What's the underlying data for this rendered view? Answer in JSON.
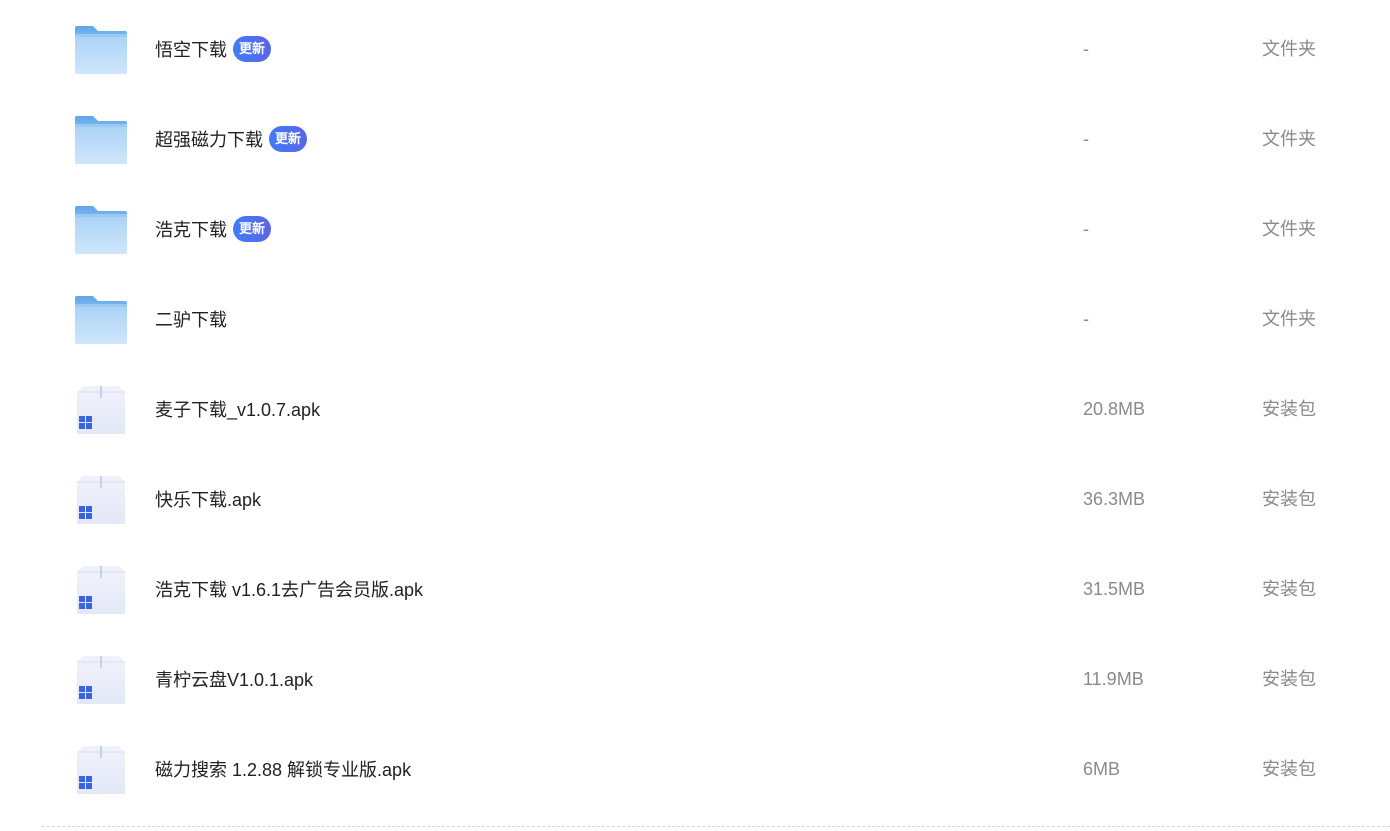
{
  "colors": {
    "badge_start": "#3f7df6",
    "badge_end": "#5b64e8",
    "folder": "#8cc0f1",
    "secondary_text": "#8a8a8a"
  },
  "files": [
    {
      "name": "悟空下载",
      "badge": "更新",
      "size": "-",
      "type": "文件夹",
      "icon": "folder-icon"
    },
    {
      "name": "超强磁力下载",
      "badge": "更新",
      "size": "-",
      "type": "文件夹",
      "icon": "folder-icon"
    },
    {
      "name": "浩克下载",
      "badge": "更新",
      "size": "-",
      "type": "文件夹",
      "icon": "folder-icon"
    },
    {
      "name": "二驴下载",
      "size": "-",
      "type": "文件夹",
      "icon": "folder-icon"
    },
    {
      "name": "麦子下载_v1.0.7.apk",
      "size": "20.8MB",
      "type": "安装包",
      "icon": "package-icon"
    },
    {
      "name": "快乐下载.apk",
      "size": "36.3MB",
      "type": "安装包",
      "icon": "package-icon"
    },
    {
      "name": "浩克下载 v1.6.1去广告会员版.apk",
      "size": "31.5MB",
      "type": "安装包",
      "icon": "package-icon"
    },
    {
      "name": "青柠云盘V1.0.1.apk",
      "size": "11.9MB",
      "type": "安装包",
      "icon": "package-icon"
    },
    {
      "name": "磁力搜索 1.2.88 解锁专业版.apk",
      "size": "6MB",
      "type": "安装包",
      "icon": "package-icon"
    }
  ]
}
